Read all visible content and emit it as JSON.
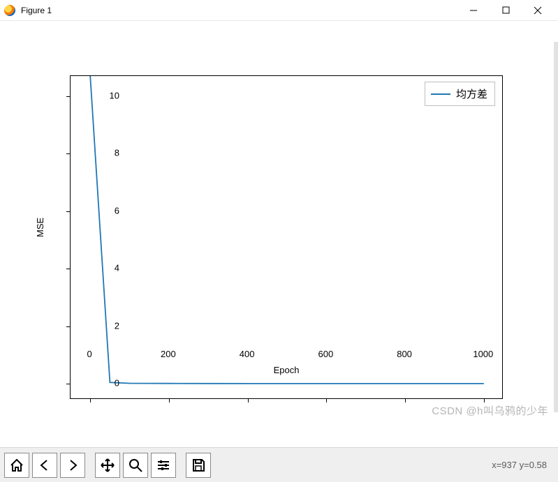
{
  "window": {
    "title": "Figure 1"
  },
  "toolbar": {
    "coord_readout": "x=937  y=0.58"
  },
  "watermark": "CSDN @h叫乌鸦的少年",
  "chart_data": {
    "type": "line",
    "x": [
      0,
      50,
      100,
      200,
      300,
      400,
      500,
      600,
      700,
      800,
      900,
      1000
    ],
    "series": [
      {
        "name": "均方差",
        "values": [
          10.7,
          0.05,
          0.02,
          0.015,
          0.012,
          0.011,
          0.01,
          0.01,
          0.01,
          0.01,
          0.01,
          0.01
        ]
      }
    ],
    "xlabel": "Epoch",
    "ylabel": "MSE",
    "xlim": [
      -50,
      1050
    ],
    "ylim": [
      -0.55,
      10.7
    ],
    "xticks": [
      0,
      200,
      400,
      600,
      800,
      1000
    ],
    "yticks": [
      0,
      2,
      4,
      6,
      8,
      10
    ],
    "legend_position": "upper right"
  }
}
